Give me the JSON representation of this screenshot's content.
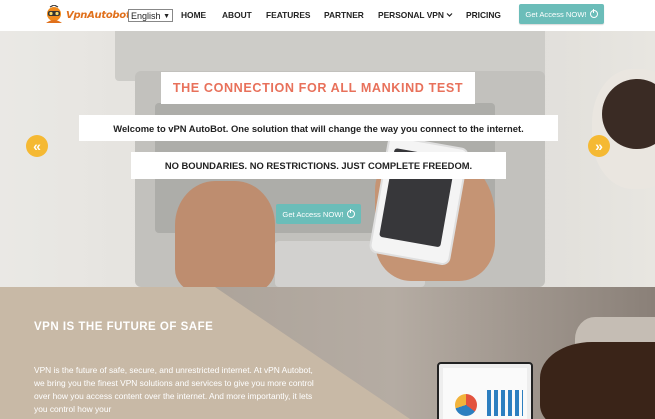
{
  "nav": {
    "logo_text": "VpnAutobot",
    "language": "English",
    "items": [
      {
        "label": "HOME"
      },
      {
        "label": "ABOUT"
      },
      {
        "label": "FEATURES"
      },
      {
        "label": "PARTNER"
      },
      {
        "label": "PERSONAL VPN"
      },
      {
        "label": "PRICING"
      }
    ],
    "cta_label": "Get Access NOW!"
  },
  "hero": {
    "title": "THE CONNECTION FOR ALL MANKIND TEST",
    "welcome": "Welcome to vPN AutoBot. One solution that will change the way you connect to the internet.",
    "tagline": "NO BOUNDARIES. NO RESTRICTIONS. JUST COMPLETE FREEDOM.",
    "cta_label": "Get Access NOW!",
    "prev_icon": "«",
    "next_icon": "»"
  },
  "section": {
    "title": "VPN IS THE FUTURE OF SAFE",
    "text": "VPN is the future of safe, secure, and unrestricted internet. At vPN Autobot, we bring you the finest VPN solutions and services to give you more control over how you access content over the internet. And more importantly, it lets you control how your"
  },
  "colors": {
    "accent": "#6bbdb9",
    "title_red": "#e8715b",
    "arrow_yellow": "#f5b933",
    "logo_orange": "#e0701c"
  }
}
